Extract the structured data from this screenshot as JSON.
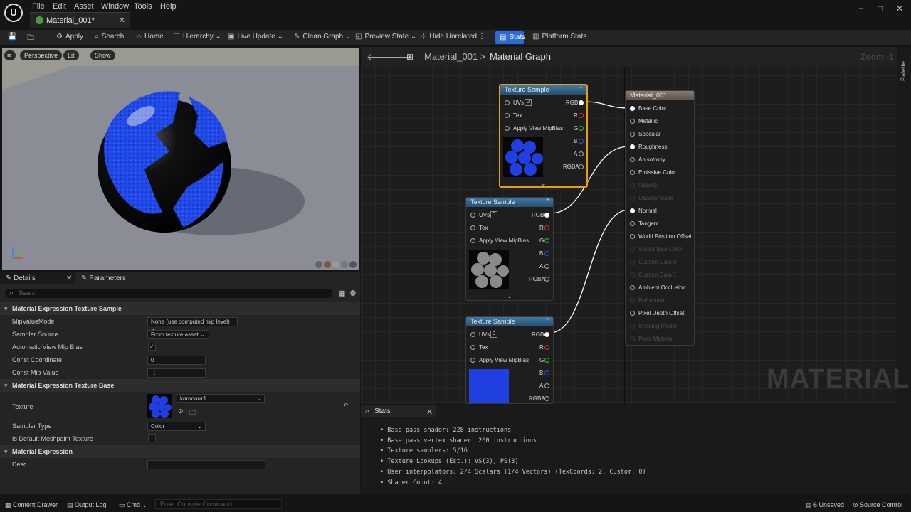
{
  "app": {
    "logo": "U"
  },
  "menu": [
    "File",
    "Edit",
    "Asset",
    "Window",
    "Tools",
    "Help"
  ],
  "tab": {
    "label": "Material_001*"
  },
  "window_controls": [
    "−",
    "□",
    "✕"
  ],
  "toolbar": {
    "apply": "Apply",
    "search": "Search",
    "home": "Home",
    "hierarchy": "Hierarchy",
    "live_update": "Live Update",
    "clean_graph": "Clean Graph",
    "preview_state": "Preview State",
    "hide_unrelated": "Hide Unrelated",
    "stats": "Stats",
    "platform_stats": "Platform Stats"
  },
  "viewport": {
    "perspective": "Perspective",
    "lit": "Lit",
    "show": "Show"
  },
  "details": {
    "tab_details": "Details",
    "tab_parameters": "Parameters",
    "search_placeholder": "Search",
    "section1": "Material Expression Texture Sample",
    "mip_value_mode_label": "MipValueMode",
    "mip_value_mode": "None (use computed mip level)",
    "sampler_source_label": "Sampler Source",
    "sampler_source": "From texture asset",
    "auto_view_mip_bias_label": "Automatic View Mip Bias",
    "const_coordinate_label": "Const Coordinate",
    "const_coordinate": "0",
    "const_mip_value_label": "Const Mip Value",
    "const_mip_value": "-1",
    "section2": "Material Expression Texture Base",
    "texture_label": "Texture",
    "texture_value": "korooorrr1",
    "sampler_type_label": "Sampler Type",
    "sampler_type": "Color",
    "is_default_meshpaint_label": "Is Default Meshpaint Texture",
    "section3": "Material Expression",
    "desc_label": "Desc"
  },
  "graph": {
    "breadcrumb_root": "Material_001",
    "breadcrumb_sep": ">",
    "breadcrumb_current": "Material Graph",
    "zoom": "Zoom -1",
    "palette": "Palette",
    "watermark": "MATERIAL",
    "nodes": [
      {
        "title": "Texture Sample",
        "uv": "0"
      },
      {
        "title": "Texture Sample",
        "uv": "0"
      },
      {
        "title": "Texture Sample",
        "uv": "0"
      }
    ],
    "node_inputs": [
      "UVs",
      "Tex",
      "Apply View MipBias"
    ],
    "node_outputs": [
      "RGB",
      "R",
      "G",
      "B",
      "A",
      "RGBA"
    ],
    "output_node": {
      "title": "Material_001",
      "pins": [
        {
          "label": "Base Color",
          "active": true
        },
        {
          "label": "Metallic",
          "active": true
        },
        {
          "label": "Specular",
          "active": true
        },
        {
          "label": "Roughness",
          "active": true
        },
        {
          "label": "Anisotropy",
          "active": true
        },
        {
          "label": "Emissive Color",
          "active": true
        },
        {
          "label": "Opacity",
          "active": false
        },
        {
          "label": "Opacity Mask",
          "active": false
        },
        {
          "label": "Normal",
          "active": true
        },
        {
          "label": "Tangent",
          "active": true
        },
        {
          "label": "World Position Offset",
          "active": true
        },
        {
          "label": "Subsurface Color",
          "active": false
        },
        {
          "label": "Custom Data 0",
          "active": false
        },
        {
          "label": "Custom Data 1",
          "active": false
        },
        {
          "label": "Ambient Occlusion",
          "active": true
        },
        {
          "label": "Refraction",
          "active": false
        },
        {
          "label": "Pixel Depth Offset",
          "active": true
        },
        {
          "label": "Shading Model",
          "active": false
        },
        {
          "label": "Front Material",
          "active": false
        }
      ]
    }
  },
  "stats": {
    "tab": "Stats",
    "lines": [
      "Base pass shader: 228 instructions",
      "Base pass vertex shader: 260 instructions",
      "Texture samplers: 5/16",
      "Texture Lookups (Est.): VS(3), PS(3)",
      "User interpolators: 2/4 Scalars (1/4 Vectors) (TexCoords: 2, Custom: 0)",
      "Shader Count: 4"
    ]
  },
  "statusbar": {
    "content_drawer": "Content Drawer",
    "output_log": "Output Log",
    "cmd": "Cmd",
    "console_placeholder": "Enter Console Command",
    "unsaved": "6 Unsaved",
    "source_control": "Source Control"
  },
  "colors": {
    "accent": "#2b6bd3",
    "selected_node": "#e5a00d",
    "node_header": "#3f79a8",
    "texture_blue": "#1f3fe0"
  }
}
